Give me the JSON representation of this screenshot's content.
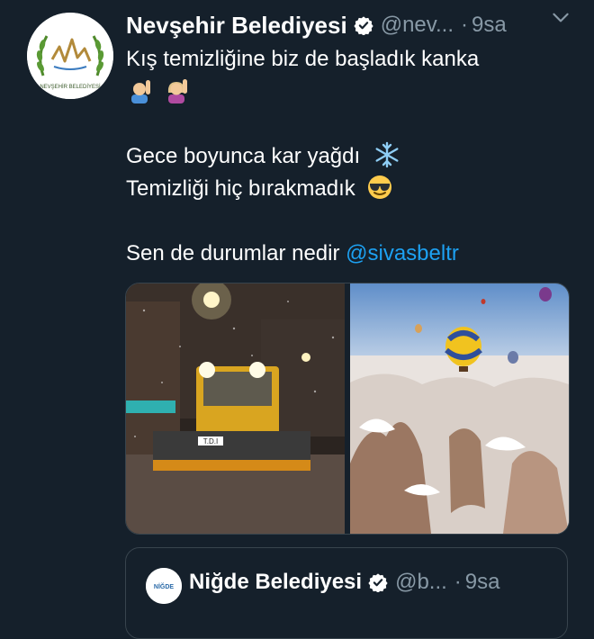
{
  "tweet": {
    "author_name": "Nevşehir Belediyesi",
    "handle": "@nev...",
    "separator": "·",
    "time": "9sa",
    "avatar_caption": "NEVŞEHİR BELEDİYESİ",
    "text_line1": "Kış temizliğine biz de başladık kanka",
    "text_line3": "Gece boyunca kar yağdı",
    "text_line4": "Temizliği hiç bırakmadık",
    "text_line6_prefix": "Sen de durumlar nedir ",
    "mention": "@sivasbeltr",
    "emojis": [
      "man-raising-hand",
      "woman-raising-hand",
      "snowflake",
      "sunglasses-face"
    ]
  },
  "media": {
    "images": [
      "snow-plow-night",
      "cappadocia-balloons-snow"
    ],
    "plow_sign": "T.D.I"
  },
  "quote": {
    "author_name": "Niğde Belediyesi",
    "handle": "@b...",
    "separator": "·",
    "time": "9sa",
    "avatar_text": "NİĞDE"
  },
  "colors": {
    "background": "#15202b",
    "secondary_text": "#8899a6",
    "link": "#1da1f2",
    "border": "#38444d",
    "verified_badge": "#ffffff"
  }
}
